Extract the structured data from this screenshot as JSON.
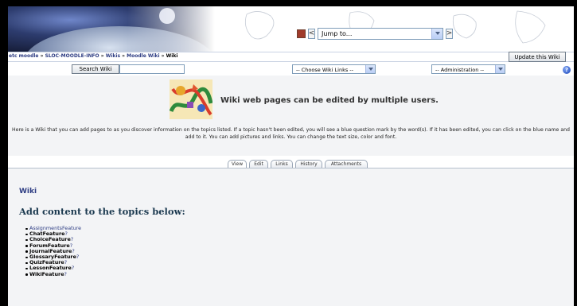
{
  "header": {
    "jump_label": "Jump to...",
    "prev_label": "<",
    "next_label": ">"
  },
  "breadcrumb": {
    "items": [
      "etc moodle",
      "SLOC-MOODLE-INFO",
      "Wikis",
      "Moodle Wiki"
    ],
    "current": "Wiki",
    "separator": "»"
  },
  "update_button": "Update this Wiki",
  "controls": {
    "search_button": "Search Wiki",
    "search_value": "",
    "wiki_links": "-- Choose Wiki Links --",
    "administration": "-- Administration --",
    "help_label": "?"
  },
  "intro": {
    "headline": "Wiki web pages can be edited by multiple users.",
    "text": "Here is a Wiki that you can add pages to as you discover information on the topics listed. If a topic hasn't been edited, you will see a blue question mark by the word(s). If it has been edited, you can click on the blue name and add to it. You can add pictures and links. You can change the text size, color and font."
  },
  "tabs": [
    "View",
    "Edit",
    "Links",
    "History",
    "Attachments"
  ],
  "main": {
    "wiki_title": "Wiki",
    "heading": "Add content to the topics below:",
    "topics": [
      {
        "label": "AssignmentsFeature",
        "q": ""
      },
      {
        "label": "ChatFeature",
        "q": "?"
      },
      {
        "label": "ChoiceFeature",
        "q": "?"
      },
      {
        "label": "ForumFeature",
        "q": "?"
      },
      {
        "label": "JournalFeature",
        "q": "?"
      },
      {
        "label": "GlossaryFeature",
        "q": "?"
      },
      {
        "label": "QuizFeature",
        "q": "?"
      },
      {
        "label": "LessonFeature",
        "q": "?"
      },
      {
        "label": "WikiFeature",
        "q": "?"
      }
    ]
  },
  "colors": {
    "link": "#2d3c83",
    "content_bg": "#f3f4f6",
    "border": "#000000"
  }
}
